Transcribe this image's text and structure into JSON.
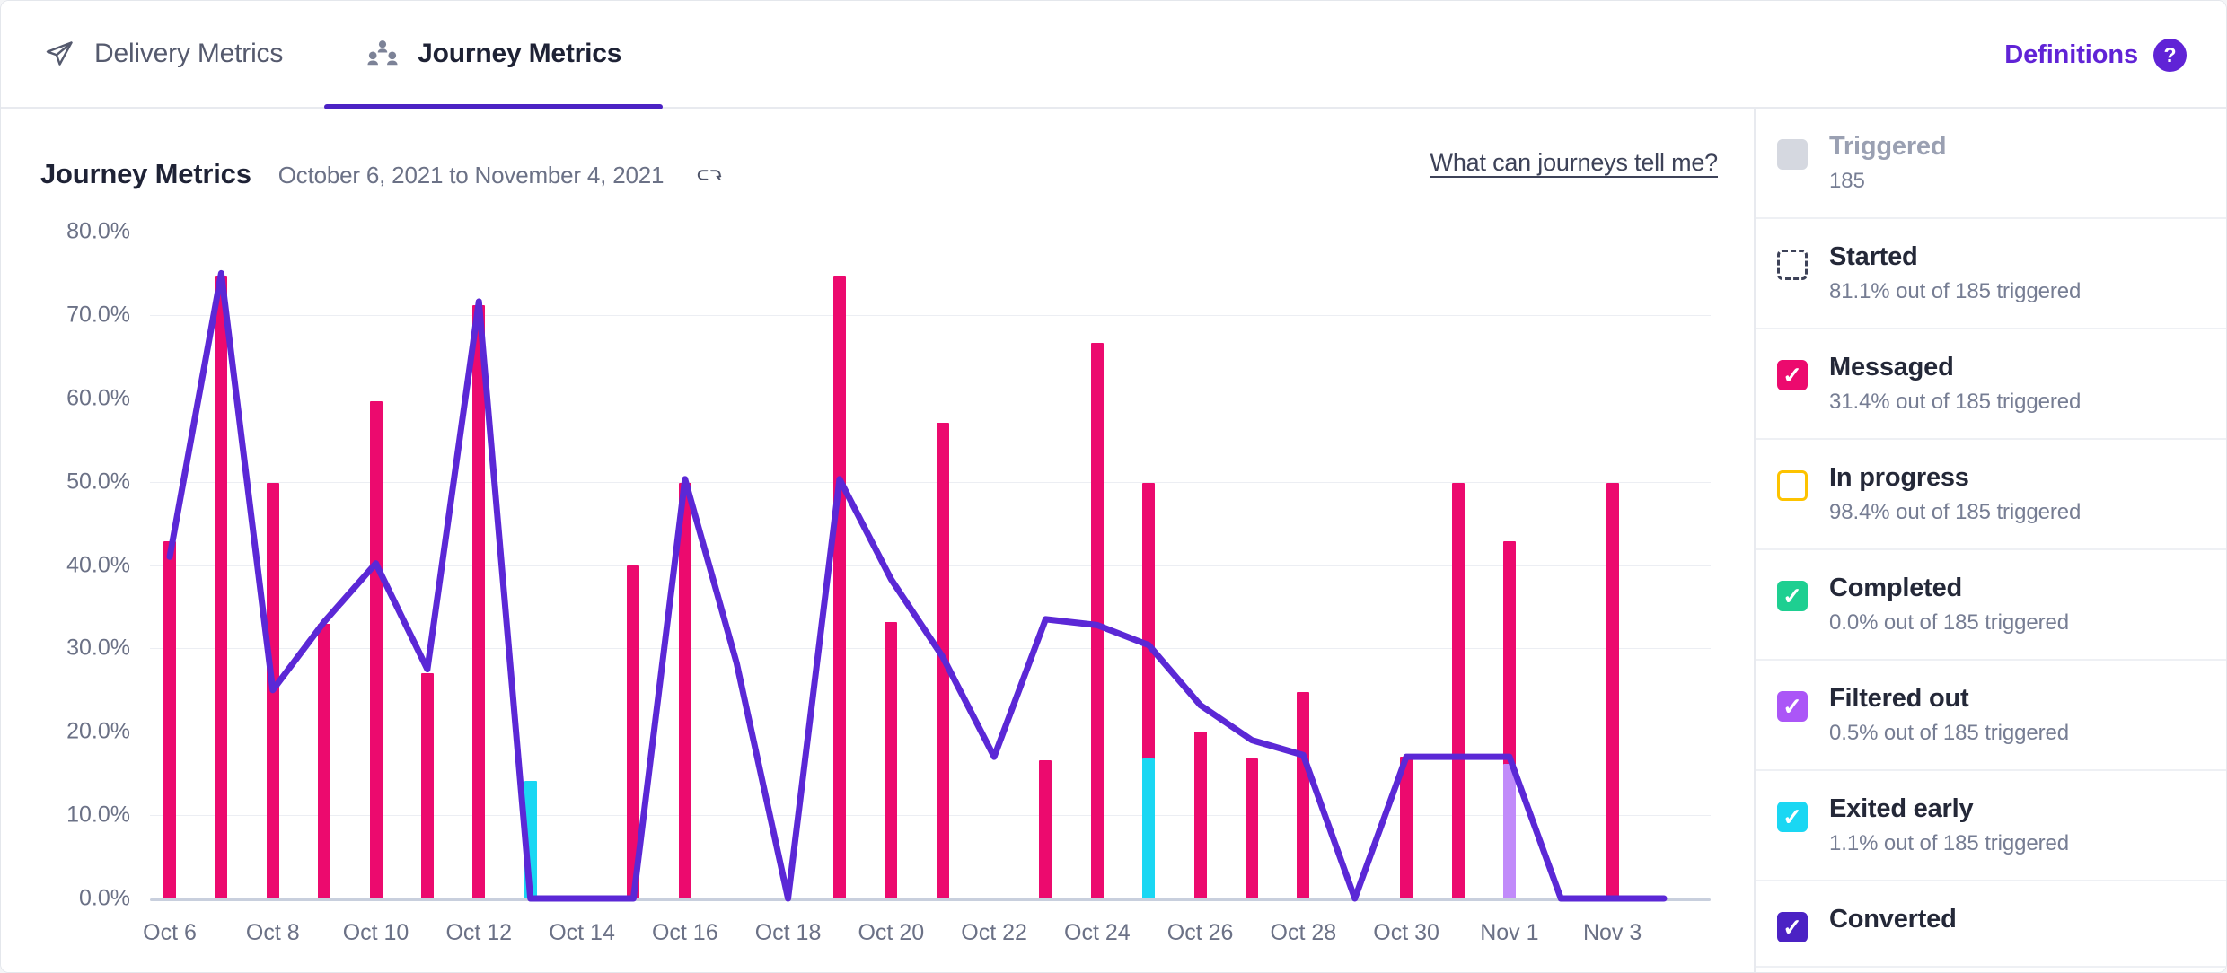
{
  "tabs": [
    {
      "label": "Delivery Metrics",
      "icon": "paper-plane-icon",
      "active": false
    },
    {
      "label": "Journey Metrics",
      "icon": "people-group-icon",
      "active": true
    }
  ],
  "header": {
    "definitions_label": "Definitions",
    "help_badge": "?"
  },
  "chart_header": {
    "title": "Journey Metrics",
    "date_range": "October 6, 2021 to November 4, 2021",
    "link_icon": "link-icon",
    "tell_me_link": "What can journeys tell me?"
  },
  "legend": {
    "items": [
      {
        "label": "Triggered",
        "sub": "185",
        "color": "#d5d8e0",
        "state": "filled",
        "muted": true
      },
      {
        "label": "Started",
        "sub": "81.1% out of 185 triggered",
        "color": "#3d4258",
        "state": "dashed",
        "muted": false
      },
      {
        "label": "Messaged",
        "sub": "31.4% out of 185 triggered",
        "color": "#ec0a6e",
        "state": "checked",
        "muted": false
      },
      {
        "label": "In progress",
        "sub": "98.4% out of 185 triggered",
        "color": "#fdc300",
        "state": "outline",
        "muted": false
      },
      {
        "label": "Completed",
        "sub": "0.0% out of 185 triggered",
        "color": "#1ecf91",
        "state": "checked",
        "muted": false
      },
      {
        "label": "Filtered out",
        "sub": "0.5% out of 185 triggered",
        "color": "#ab56f7",
        "state": "checked",
        "muted": false
      },
      {
        "label": "Exited early",
        "sub": "1.1% out of 185 triggered",
        "color": "#1ad7f3",
        "state": "checked",
        "muted": false
      },
      {
        "label": "Converted",
        "sub": "",
        "color": "#4b22c4",
        "state": "checked",
        "muted": false
      }
    ]
  },
  "chart_data": {
    "type": "bar",
    "title": "Journey Metrics",
    "subtitle": "October 6, 2021 to November 4, 2021",
    "xlabel": "",
    "ylabel": "",
    "ylim": [
      0,
      80
    ],
    "ytick_labels": [
      "0.0%",
      "10.0%",
      "20.0%",
      "30.0%",
      "40.0%",
      "50.0%",
      "60.0%",
      "70.0%",
      "80.0%"
    ],
    "ytick_values": [
      0,
      10,
      20,
      30,
      40,
      50,
      60,
      70,
      80
    ],
    "grid": true,
    "legend_position": "right-panel",
    "x": [
      "Oct 6",
      "Oct 7",
      "Oct 8",
      "Oct 9",
      "Oct 10",
      "Oct 11",
      "Oct 12",
      "Oct 13",
      "Oct 14",
      "Oct 15",
      "Oct 16",
      "Oct 17",
      "Oct 18",
      "Oct 19",
      "Oct 20",
      "Oct 21",
      "Oct 22",
      "Oct 23",
      "Oct 24",
      "Oct 25",
      "Oct 26",
      "Oct 27",
      "Oct 28",
      "Oct 29",
      "Oct 30",
      "Oct 31",
      "Nov 1",
      "Nov 2",
      "Nov 3",
      "Nov 4"
    ],
    "xtick_labels": [
      "Oct 6",
      "Oct 8",
      "Oct 10",
      "Oct 12",
      "Oct 14",
      "Oct 16",
      "Oct 18",
      "Oct 20",
      "Oct 22",
      "Oct 24",
      "Oct 26",
      "Oct 28",
      "Oct 30",
      "Nov 1",
      "Nov 3"
    ],
    "series": [
      {
        "name": "Messaged",
        "type": "bar",
        "color": "#ec0a6e",
        "values": [
          42.8,
          74.6,
          49.9,
          33.0,
          59.6,
          27.0,
          71.2,
          11.0,
          0,
          40.0,
          49.9,
          0,
          0,
          74.6,
          33.2,
          57.1,
          0,
          16.6,
          66.6,
          49.9,
          20.0,
          16.8,
          24.8,
          0,
          17.0,
          49.9,
          42.8,
          0,
          49.9,
          0
        ]
      },
      {
        "name": "Exited early",
        "type": "bar",
        "color": "#1ad7f3",
        "values": [
          0,
          0,
          0,
          0,
          0,
          0,
          0,
          14.1,
          0,
          0,
          0,
          0,
          0,
          0,
          0,
          0,
          0,
          0,
          0,
          16.8,
          0,
          0,
          0,
          0,
          0,
          0,
          0,
          0,
          0,
          0
        ]
      },
      {
        "name": "Filtered out",
        "type": "bar",
        "color": "#c18bfa",
        "values": [
          0,
          0,
          0,
          0,
          0,
          0,
          0,
          0,
          0,
          0,
          0,
          0,
          0,
          0,
          0,
          0,
          0,
          0,
          0,
          0,
          0,
          0,
          0,
          0,
          0,
          0,
          16.1,
          0,
          0,
          0
        ]
      },
      {
        "name": "Started",
        "type": "line",
        "color": "#5b28d6",
        "values": [
          41.0,
          75.0,
          25.0,
          33.2,
          40.2,
          27.5,
          71.6,
          0.0,
          0.0,
          0.0,
          50.3,
          28.3,
          0.0,
          50.3,
          38.3,
          29.0,
          17.0,
          33.5,
          32.8,
          30.4,
          23.2,
          19.0,
          17.2,
          0.0,
          17.0,
          17.0,
          17.0,
          0.0,
          0.0,
          0.0
        ]
      }
    ]
  }
}
